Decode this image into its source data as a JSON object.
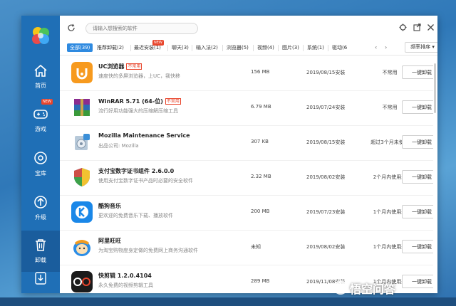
{
  "colors": {
    "sidebar": "#1f6fb6",
    "accent": "#2f8ae0",
    "tag_red": "#e8452c"
  },
  "sidebar": {
    "items": [
      {
        "label": "首页",
        "icon": "home-icon"
      },
      {
        "label": "游戏",
        "icon": "gamepad-icon",
        "badge": "NEW"
      },
      {
        "label": "宝库",
        "icon": "treasure-disk-icon"
      },
      {
        "label": "升级",
        "icon": "upgrade-arrow-icon"
      },
      {
        "label": "卸载",
        "icon": "trash-icon",
        "active": true
      },
      {
        "label": "",
        "icon": "download-icon"
      }
    ]
  },
  "topbar": {
    "search_placeholder": "请输入想搜索的软件"
  },
  "tabs": [
    {
      "label": "全部(39)",
      "active": true
    },
    {
      "label": "推荐卸载(2)"
    },
    {
      "label": "最近安装(1)",
      "badge": "NEW"
    },
    {
      "label": "聊天(3)"
    },
    {
      "label": "输入法(2)"
    },
    {
      "label": "浏览器(5)"
    },
    {
      "label": "视频(4)"
    },
    {
      "label": "图片(3)"
    },
    {
      "label": "系统(1)"
    },
    {
      "label": "驱动(6"
    }
  ],
  "sort_label": "频率排序 ▾",
  "uninstall_label": "一键卸载",
  "apps": [
    {
      "name": "UC浏览器",
      "tag": "不常用",
      "desc": "速度快的多屏浏览器，上UC，我快移",
      "size": "156 MB",
      "date": "2019/08/15安装",
      "usage": "不常用",
      "icon": "uc-browser-icon"
    },
    {
      "name": "WinRAR 5.71 (64-位)",
      "tag": "不常用",
      "desc": "流行好用功能强大的压缩解压缩工具",
      "size": "6.79 MB",
      "date": "2019/07/24安装",
      "usage": "不常用",
      "icon": "winrar-icon"
    },
    {
      "name": "Mozilla Maintenance Service",
      "tag": "",
      "desc": "出品公司: Mozilla",
      "size": "307 KB",
      "date": "2019/08/15安装",
      "usage": "超过3个月未使用",
      "icon": "mozilla-installer-icon"
    },
    {
      "name": "支付宝数字证书组件 2.6.0.0",
      "tag": "",
      "desc": "使用支付宝数字证书产品时必要的安全软件",
      "size": "2.32 MB",
      "date": "2019/08/02安装",
      "usage": "2个月内使用过",
      "icon": "shield-icon"
    },
    {
      "name": "酷狗音乐",
      "tag": "",
      "desc": "更欢迎的免费音乐下载、播放软件",
      "size": "200 MB",
      "date": "2019/07/23安装",
      "usage": "1个月内使用过",
      "icon": "kugou-icon"
    },
    {
      "name": "阿里旺旺",
      "tag": "",
      "desc": "为淘宝购物度身定做的免费网上商务沟通软件",
      "size": "未知",
      "date": "2019/08/02安装",
      "usage": "1个月内使用过",
      "icon": "aliwangwang-icon"
    },
    {
      "name": "快剪辑 1.2.0.4104",
      "tag": "",
      "desc": "永久免费的视频剪辑工具",
      "size": "289 MB",
      "date": "2019/11/08安装",
      "usage": "1个月内使用过",
      "icon": "kuaijianji-icon"
    }
  ],
  "watermark": "悟空问答"
}
